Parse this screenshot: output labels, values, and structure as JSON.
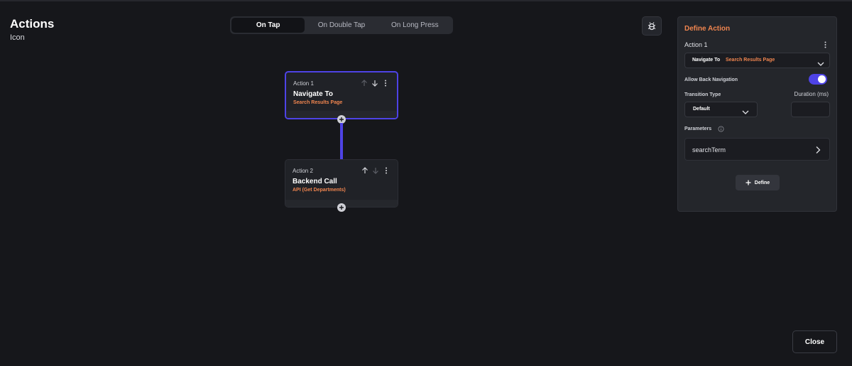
{
  "header": {
    "title": "Actions",
    "subtitle": "Icon"
  },
  "tabs": [
    {
      "label": "On Tap",
      "active": true
    },
    {
      "label": "On Double Tap",
      "active": false
    },
    {
      "label": "On Long Press",
      "active": false
    }
  ],
  "debug_button": {
    "icon": "bug-icon"
  },
  "actions": [
    {
      "label": "Action 1",
      "title": "Navigate To",
      "subtitle": "Search Results Page",
      "selected": true
    },
    {
      "label": "Action 2",
      "title": "Backend Call",
      "subtitle": "API (Get Departments)",
      "selected": false
    }
  ],
  "panel": {
    "title": "Define Action",
    "action_label": "Action 1",
    "action_select": {
      "type": "Navigate To",
      "target": "Search Results Page"
    },
    "allow_back_label": "Allow Back Navigation",
    "allow_back_on": true,
    "transition_label": "Transition Type",
    "transition_value": "Default",
    "duration_label": "Duration (ms)",
    "duration_value": "",
    "parameters_label": "Parameters",
    "parameter_name": "searchTerm",
    "define_label": "Define"
  },
  "close_label": "Close",
  "colors": {
    "accent": "#4e43e6",
    "highlight": "#f0854f",
    "background": "#16171b"
  }
}
